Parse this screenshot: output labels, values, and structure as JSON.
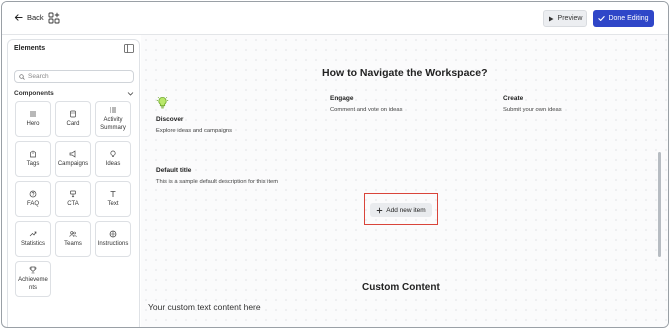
{
  "topbar": {
    "back_label": "Back",
    "preview_label": "Preview",
    "done_label": "Done Editing",
    "accent_color": "#2f46c8"
  },
  "sidebar": {
    "title": "Elements",
    "search_placeholder": "Search",
    "section_label": "Components",
    "components": [
      {
        "label": "Hero",
        "icon": "hero-icon"
      },
      {
        "label": "Card",
        "icon": "card-icon"
      },
      {
        "label": "Activity Summary",
        "icon": "activity-icon"
      },
      {
        "label": "Tags",
        "icon": "tags-icon"
      },
      {
        "label": "Campaigns",
        "icon": "campaigns-icon"
      },
      {
        "label": "Ideas",
        "icon": "ideas-icon"
      },
      {
        "label": "FAQ",
        "icon": "faq-icon"
      },
      {
        "label": "CTA",
        "icon": "cta-icon"
      },
      {
        "label": "Text",
        "icon": "text-icon"
      },
      {
        "label": "Statistics",
        "icon": "statistics-icon"
      },
      {
        "label": "Teams",
        "icon": "teams-icon"
      },
      {
        "label": "Instructions",
        "icon": "instructions-icon"
      },
      {
        "label": "Achievements",
        "icon": "achievements-icon"
      }
    ]
  },
  "canvas": {
    "nav_title": "How to Navigate the Workspace?",
    "discover": {
      "title": "Discover",
      "desc": "Explore ideas and campaigns"
    },
    "engage": {
      "title": "Engage",
      "desc": "Comment and vote on ideas"
    },
    "create": {
      "title": "Create",
      "desc": "Submit your own ideas"
    },
    "default_item": {
      "title": "Default title",
      "desc": "This is a sample default description for this item"
    },
    "add_item_label": "Add new item",
    "custom_title": "Custom Content",
    "custom_text": "Your custom text content here",
    "highlight_color": "#d9443a"
  }
}
